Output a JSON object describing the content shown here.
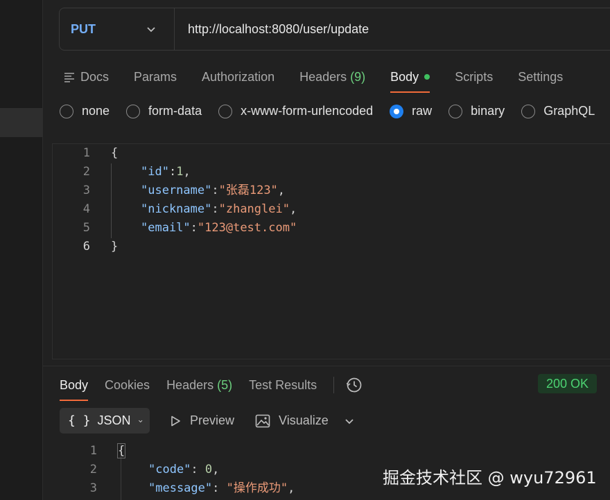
{
  "request": {
    "method": "PUT",
    "url": "http://localhost:8080/user/update",
    "tabs": [
      {
        "label": "Docs"
      },
      {
        "label": "Params"
      },
      {
        "label": "Authorization"
      },
      {
        "label": "Headers",
        "count": "(9)"
      },
      {
        "label": "Body"
      },
      {
        "label": "Scripts"
      },
      {
        "label": "Settings"
      }
    ],
    "body_types": [
      "none",
      "form-data",
      "x-www-form-urlencoded",
      "raw",
      "binary",
      "GraphQL"
    ],
    "selected_body_type": "raw",
    "editor": {
      "line_numbers": [
        "1",
        "2",
        "3",
        "4",
        "5",
        "6"
      ],
      "lines": [
        {
          "open": "{"
        },
        {
          "key": "\"id\"",
          "sep": ":",
          "value": "1",
          "end": ","
        },
        {
          "key": "\"username\"",
          "sep": ":",
          "value": "\"张磊123\"",
          "end": ","
        },
        {
          "key": "\"nickname\"",
          "sep": ":",
          "value": "\"zhanglei\"",
          "end": ","
        },
        {
          "key": "\"email\"",
          "sep": ":",
          "value": "\"123@test.com\"",
          "end": ""
        },
        {
          "close": "}"
        }
      ]
    }
  },
  "response": {
    "tabs": [
      {
        "label": "Body"
      },
      {
        "label": "Cookies"
      },
      {
        "label": "Headers",
        "count": "(5)"
      },
      {
        "label": "Test Results"
      }
    ],
    "status": "200 OK",
    "format": "JSON",
    "preview_label": "Preview",
    "visualize_label": "Visualize",
    "code": {
      "line_numbers": [
        "1",
        "2",
        "3"
      ],
      "open": "{",
      "l2_key": "\"code\"",
      "l2_sep": ": ",
      "l2_value": "0",
      "l2_end": ",",
      "l3_key": "\"message\"",
      "l3_sep": ": ",
      "l3_value": "\"操作成功\"",
      "l3_end": ","
    }
  },
  "watermark": "掘金技术社区 @ wyu72961",
  "colors": {
    "accent": "#f26b3a",
    "method": "#74aef6",
    "status_ok": "#4cd372",
    "radio_on": "#1f80f0"
  }
}
